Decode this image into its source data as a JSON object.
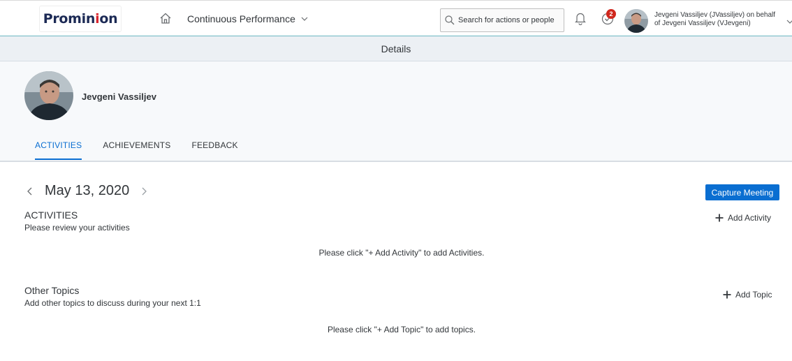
{
  "shell": {
    "logo_pre": "Promin",
    "logo_o": "i",
    "logo_post": "on",
    "app_title": "Continuous Performance",
    "search_placeholder": "Search for actions or people",
    "task_badge": "2",
    "user_line1": "Jevgeni Vassiljev (JVassiljev) on behalf",
    "user_line2": "of Jevgeni Vassiljev (VJevgeni)"
  },
  "subheader": {
    "title": "Details"
  },
  "profile": {
    "name": "Jevgeni Vassiljev",
    "tabs": [
      {
        "label": "ACTIVITIES",
        "active": true
      },
      {
        "label": "ACHIEVEMENTS",
        "active": false
      },
      {
        "label": "FEEDBACK",
        "active": false
      }
    ]
  },
  "main": {
    "date": "May 13, 2020",
    "capture_label": "Capture Meeting",
    "activities": {
      "title": "ACTIVITIES",
      "subtitle": "Please review your activities",
      "add_label": "Add Activity",
      "empty": "Please click \"+ Add Activity\" to add Activities."
    },
    "topics": {
      "title": "Other Topics",
      "subtitle": "Add other topics to discuss during your next 1:1",
      "add_label": "Add Topic",
      "empty": "Please click \"+ Add Topic\" to add topics."
    }
  },
  "colors": {
    "accent": "#0a6ed1",
    "badge": "#d0271d",
    "brand_navy": "#1c2a55",
    "brand_red": "#d9262e"
  }
}
